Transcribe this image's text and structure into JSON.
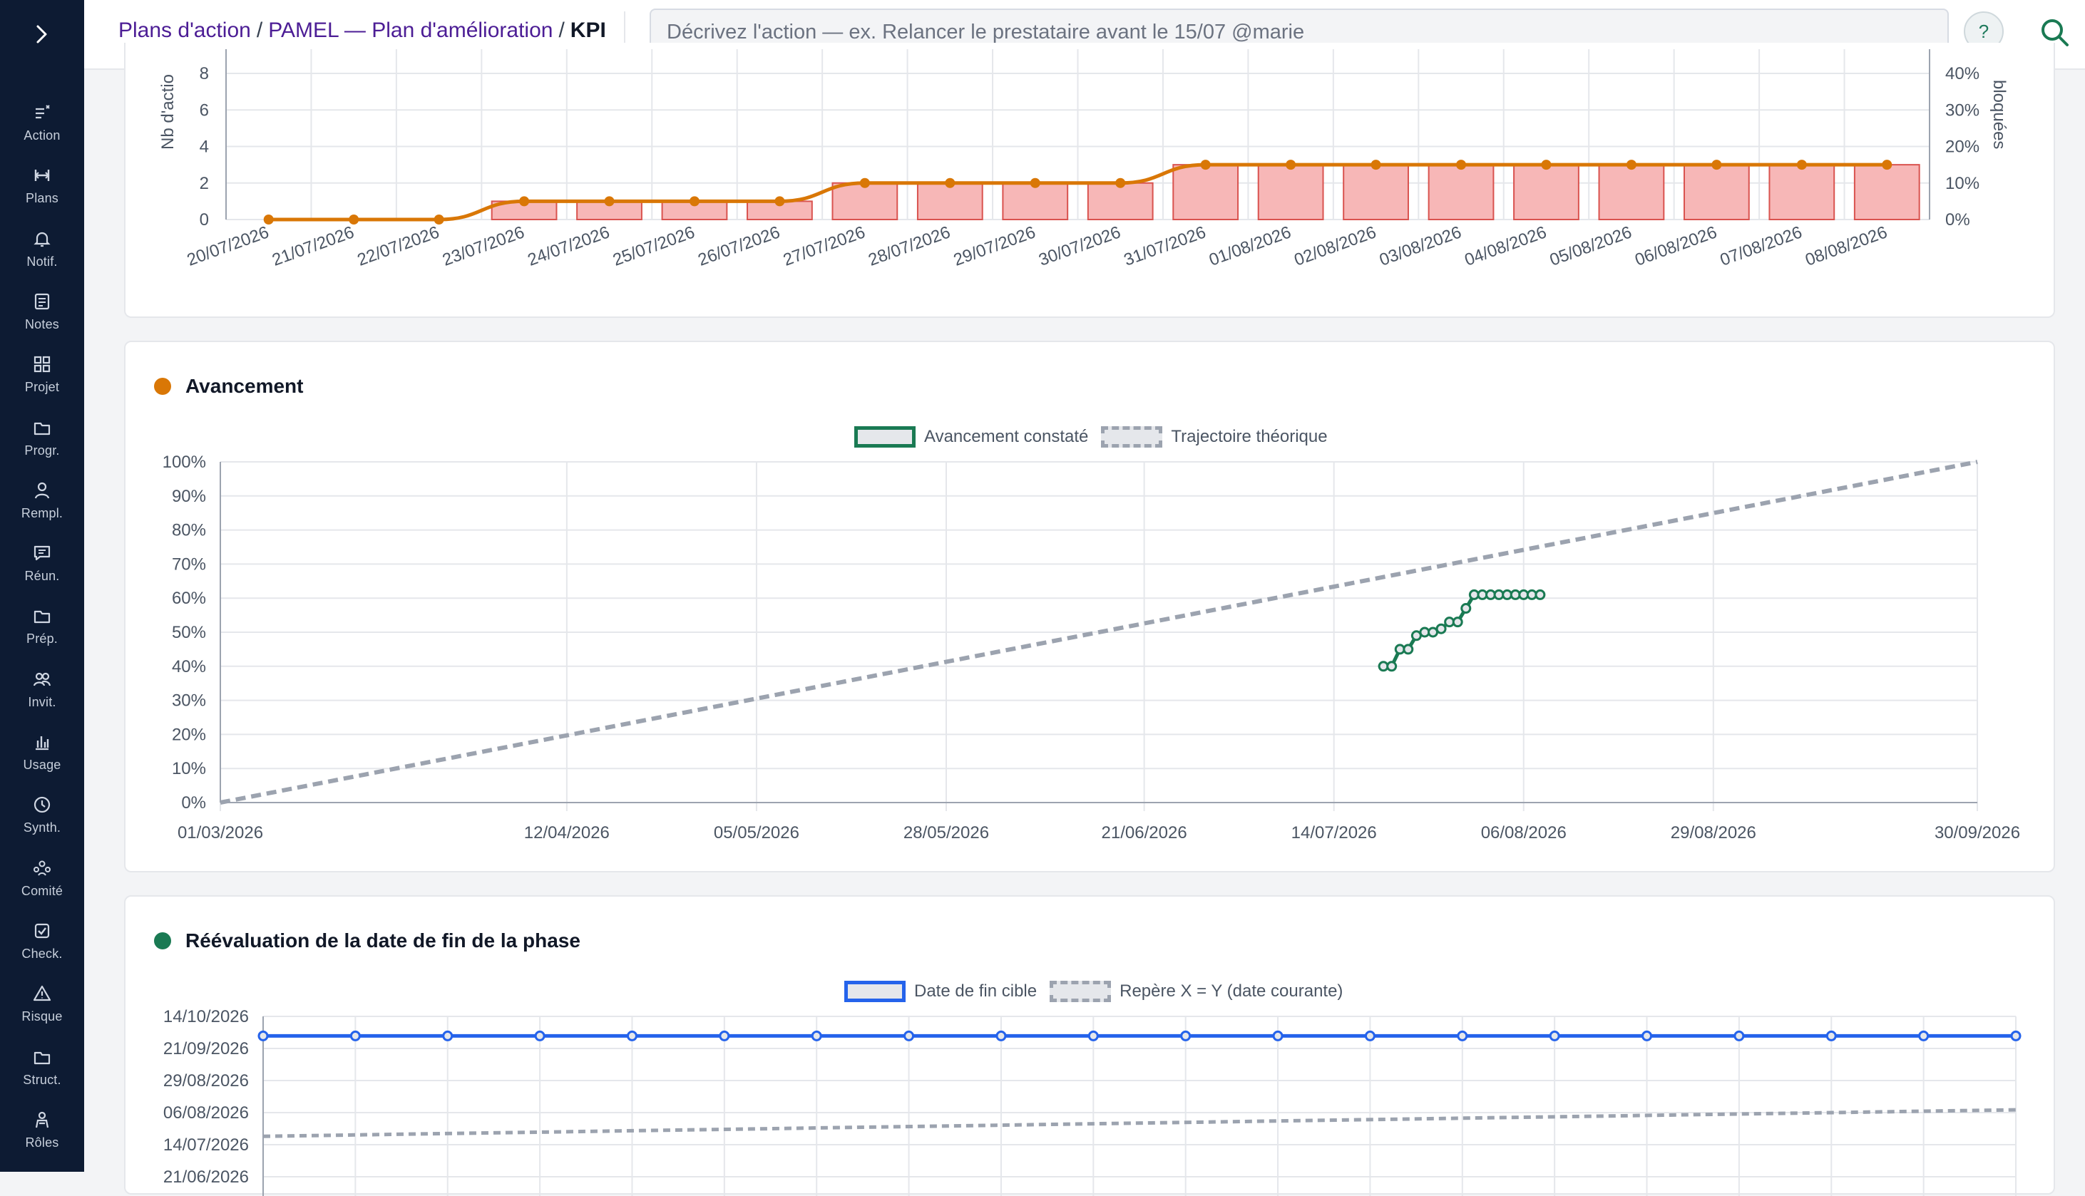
{
  "breadcrumb": {
    "items": [
      "Plans d'action",
      "PAMEL — Plan d'amélioration"
    ],
    "separator": "/",
    "current": "KPI"
  },
  "action_input": {
    "placeholder": "Décrivez l'action — ex. Relancer le prestataire avant le 15/07 @marie",
    "value": ""
  },
  "help_label": "?",
  "sidebar": {
    "items": [
      {
        "label": "Action",
        "icon": "add-list-icon"
      },
      {
        "label": "Plans",
        "icon": "plans-icon"
      },
      {
        "label": "Notif.",
        "icon": "bell-icon"
      },
      {
        "label": "Notes",
        "icon": "note-icon"
      },
      {
        "label": "Projet",
        "icon": "grid-icon"
      },
      {
        "label": "Progr.",
        "icon": "folder-icon"
      },
      {
        "label": "Rempl.",
        "icon": "user-icon"
      },
      {
        "label": "Réun.",
        "icon": "chat-icon"
      },
      {
        "label": "Prép.",
        "icon": "folder-icon"
      },
      {
        "label": "Invit.",
        "icon": "users-icon"
      },
      {
        "label": "Usage",
        "icon": "bar-chart-icon"
      },
      {
        "label": "Synth.",
        "icon": "clock-icon"
      },
      {
        "label": "Comité",
        "icon": "committee-icon"
      },
      {
        "label": "Check.",
        "icon": "checkbox-icon"
      },
      {
        "label": "Risque",
        "icon": "warning-icon"
      },
      {
        "label": "Struct.",
        "icon": "folder-icon"
      },
      {
        "label": "Rôles",
        "icon": "role-icon"
      }
    ]
  },
  "colors": {
    "brand_dark": "#0d1b33",
    "breadcrumb": "#4c1d95",
    "orange": "#d97706",
    "bar_fill": "#f7b7b7",
    "bar_stroke": "#d9534f",
    "green": "#1a7a53",
    "blue": "#2563eb",
    "dashed": "#9ca3af"
  },
  "cards": [
    {
      "title": ""
    },
    {
      "title": "Avancement",
      "dot_color": "#d97706"
    },
    {
      "title": "Réévaluation de la date de fin de la phase",
      "dot_color": "#1a7a53"
    }
  ],
  "chart_data": [
    {
      "type": "bar",
      "ylabel": "Nb d'actio",
      "y2label": "bloquées",
      "categories": [
        "20/07/2026",
        "21/07/2026",
        "22/07/2026",
        "23/07/2026",
        "24/07/2026",
        "25/07/2026",
        "26/07/2026",
        "27/07/2026",
        "28/07/2026",
        "29/07/2026",
        "30/07/2026",
        "31/07/2026",
        "01/08/2026",
        "02/08/2026",
        "03/08/2026",
        "04/08/2026",
        "05/08/2026",
        "06/08/2026",
        "07/08/2026",
        "08/08/2026"
      ],
      "yticks": [
        "0",
        "2",
        "4",
        "6",
        "8"
      ],
      "y2ticks": [
        "0%",
        "10%",
        "20%",
        "30%",
        "40%"
      ],
      "ylim": [
        0,
        8
      ],
      "y2lim": [
        0,
        40
      ],
      "series": [
        {
          "type": "bar",
          "values": [
            0,
            0,
            0,
            1,
            1,
            1,
            1,
            2,
            2,
            2,
            2,
            3,
            3,
            3,
            3,
            3,
            3,
            3,
            3,
            3
          ]
        },
        {
          "type": "line",
          "values": [
            0,
            0,
            0,
            5,
            5,
            5,
            5,
            10,
            10,
            10,
            10,
            15,
            15,
            15,
            15,
            15,
            15,
            15,
            15,
            15
          ]
        }
      ]
    },
    {
      "type": "line",
      "legend": [
        "Avancement constaté",
        "Trajectoire théorique"
      ],
      "yticks": [
        "0%",
        "10%",
        "20%",
        "30%",
        "40%",
        "50%",
        "60%",
        "70%",
        "80%",
        "90%",
        "100%"
      ],
      "xticks": [
        "01/03/2026",
        "12/04/2026",
        "05/05/2026",
        "28/05/2026",
        "21/06/2026",
        "14/07/2026",
        "06/08/2026",
        "29/08/2026",
        "30/09/2026"
      ],
      "ylim": [
        0,
        100
      ],
      "xlim": [
        "2026-03-01",
        "2026-09-30"
      ],
      "series": [
        {
          "name": "Avancement constaté",
          "points": [
            [
              "2026-07-20",
              40
            ],
            [
              "2026-07-21",
              40
            ],
            [
              "2026-07-22",
              45
            ],
            [
              "2026-07-23",
              45
            ],
            [
              "2026-07-24",
              49
            ],
            [
              "2026-07-25",
              50
            ],
            [
              "2026-07-26",
              50
            ],
            [
              "2026-07-27",
              51
            ],
            [
              "2026-07-28",
              53
            ],
            [
              "2026-07-29",
              53
            ],
            [
              "2026-07-30",
              57
            ],
            [
              "2026-07-31",
              61
            ],
            [
              "2026-08-01",
              61
            ],
            [
              "2026-08-02",
              61
            ],
            [
              "2026-08-03",
              61
            ],
            [
              "2026-08-04",
              61
            ],
            [
              "2026-08-05",
              61
            ],
            [
              "2026-08-06",
              61
            ],
            [
              "2026-08-07",
              61
            ],
            [
              "2026-08-08",
              61
            ]
          ]
        },
        {
          "name": "Trajectoire théorique",
          "points": [
            [
              "2026-03-01",
              0
            ],
            [
              "2026-09-30",
              100
            ]
          ]
        }
      ]
    },
    {
      "type": "line",
      "legend": [
        "Date de fin cible",
        "Repère X = Y (date courante)"
      ],
      "yticks": [
        "14/10/2026",
        "21/09/2026",
        "29/08/2026",
        "06/08/2026",
        "14/07/2026",
        "21/06/2026"
      ],
      "series": [
        {
          "name": "Date de fin cible",
          "points": 20,
          "value": "2026-09-30"
        },
        {
          "name": "Repère X = Y (date courante)",
          "from": "2026-07-20",
          "to": "2026-08-08"
        }
      ]
    }
  ]
}
